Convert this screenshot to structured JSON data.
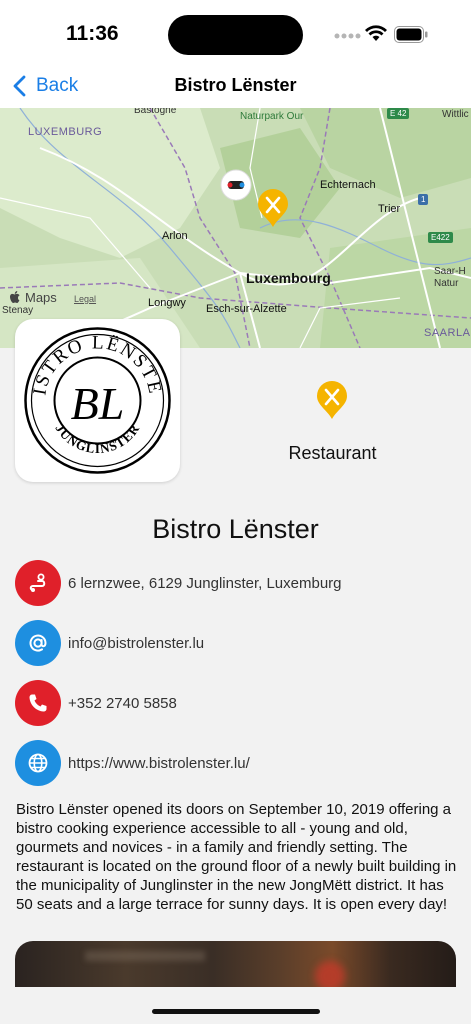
{
  "status_bar": {
    "time": "11:36"
  },
  "nav": {
    "back_label": "Back",
    "title": "Bistro Lënster"
  },
  "map": {
    "labels": {
      "bastogne": "Bastogne",
      "luxemburg_region": "LUXEMBURG",
      "naturpark": "Naturpark Our",
      "wittlich": "Wittlic",
      "echternach": "Echternach",
      "trier": "Trier",
      "arlon": "Arlon",
      "luxembourg": "Luxembourg",
      "saar_hun": "Saar-H",
      "saar_hun2": "Natur",
      "longwy": "Longwy",
      "esch": "Esch-sur-Alzette",
      "stenay": "Stenay",
      "saarland": "SAARLAN"
    },
    "road_badges": {
      "e42": "E 42",
      "a1": "1",
      "e422": "E422"
    },
    "attribution": "Maps",
    "legal": "Legal"
  },
  "logo": {
    "top_text": "BISTRO LËNSTER",
    "monogram": "BL",
    "bottom_text": "JUNGLINSTER"
  },
  "category": {
    "label": "Restaurant",
    "icon": "fork-knife-icon"
  },
  "place": {
    "name": "Bistro Lënster"
  },
  "info": {
    "address": "6 lernzwee, 6129 Junglinster, Luxemburg",
    "email": "info@bistrolenster.lu",
    "phone": "+352 2740 5858",
    "website": "https://www.bistrolenster.lu/"
  },
  "description": "Bistro Lënster opened its doors on September 10, 2019 offering a bistro cooking experience accessible to all - young and old, gourmets and novices - in a family and friendly setting. The restaurant is located on the ground floor of a newly built building in the municipality of Junglinster in the new JongMëtt district. It has 50 seats and a large terrace for sunny days. It is open every day!",
  "colors": {
    "accent": "#1a7ee6",
    "red": "#e0202a",
    "blue": "#1e8fe0",
    "pin": "#f5b400"
  }
}
